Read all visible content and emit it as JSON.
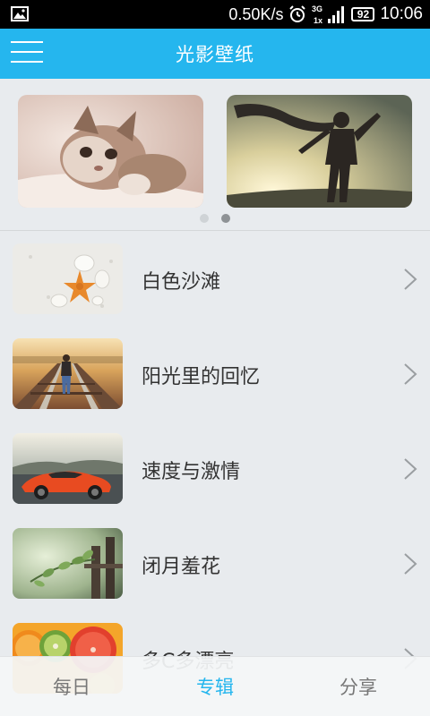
{
  "status_bar": {
    "net_speed": "0.50K/s",
    "network": "3G",
    "sim": "1x",
    "battery": "92",
    "time": "10:06",
    "icons": [
      "image-icon",
      "alarm-icon",
      "signal-icon",
      "battery-icon"
    ]
  },
  "header": {
    "title": "光影壁纸",
    "menu_icon": "hamburger-menu-icon",
    "color": "#25b6ee"
  },
  "banner": {
    "slides": [
      {
        "image": "kitten-photo"
      },
      {
        "image": "silhouette-with-scarf-photo"
      }
    ],
    "active_index": 1
  },
  "albums": [
    {
      "label": "白色沙滩",
      "thumb": "starfish-sand-photo"
    },
    {
      "label": "阳光里的回忆",
      "thumb": "railway-girl-photo"
    },
    {
      "label": "速度与激情",
      "thumb": "red-sports-car-photo"
    },
    {
      "label": "闭月羞花",
      "thumb": "plant-fence-photo"
    },
    {
      "label": "多C多漂亮",
      "thumb": "citrus-fruits-photo"
    }
  ],
  "tabs": [
    {
      "label": "每日",
      "active": false
    },
    {
      "label": "专辑",
      "active": true
    },
    {
      "label": "分享",
      "active": false
    }
  ]
}
